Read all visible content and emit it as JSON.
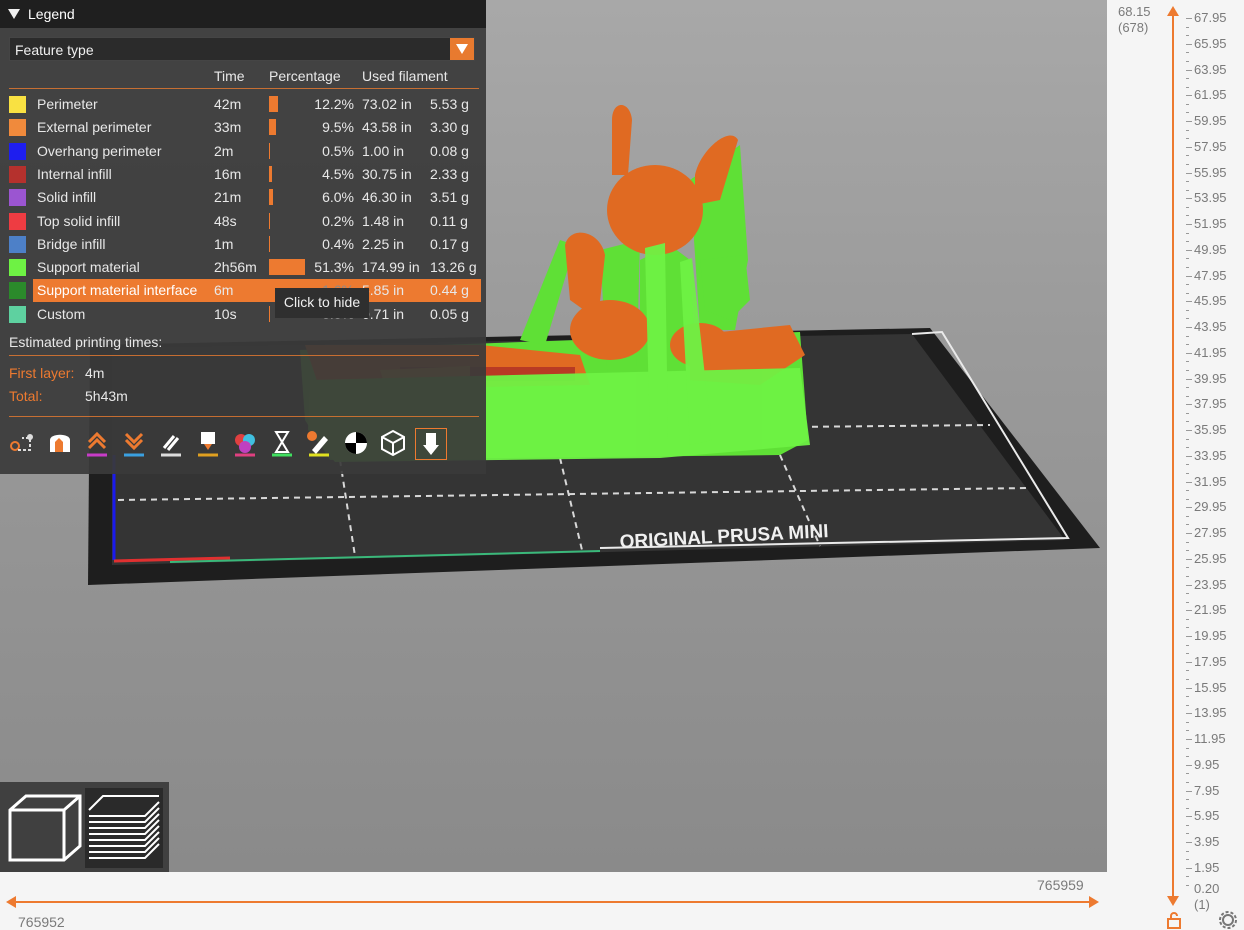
{
  "legend": {
    "title": "Legend",
    "view_type": "Feature type",
    "columns": {
      "time": "Time",
      "percentage": "Percentage",
      "used_filament": "Used filament"
    },
    "rows": [
      {
        "label": "Perimeter",
        "color": "#f9e142",
        "time": "42m",
        "percent": "12.2%",
        "pct_value": 12.2,
        "length": "73.02 in",
        "weight": "5.53 g"
      },
      {
        "label": "External perimeter",
        "color": "#f08a3c",
        "time": "33m",
        "percent": "9.5%",
        "pct_value": 9.5,
        "length": "43.58 in",
        "weight": "3.30 g"
      },
      {
        "label": "Overhang perimeter",
        "color": "#1e1eef",
        "time": "2m",
        "percent": "0.5%",
        "pct_value": 0.5,
        "length": "1.00 in",
        "weight": "0.08 g"
      },
      {
        "label": "Internal infill",
        "color": "#b5312d",
        "time": "16m",
        "percent": "4.5%",
        "pct_value": 4.5,
        "length": "30.75 in",
        "weight": "2.33 g"
      },
      {
        "label": "Solid infill",
        "color": "#9b55d1",
        "time": "21m",
        "percent": "6.0%",
        "pct_value": 6.0,
        "length": "46.30 in",
        "weight": "3.51 g"
      },
      {
        "label": "Top solid infill",
        "color": "#ee3c42",
        "time": "48s",
        "percent": "0.2%",
        "pct_value": 0.2,
        "length": "1.48 in",
        "weight": "0.11 g"
      },
      {
        "label": "Bridge infill",
        "color": "#4d80c8",
        "time": "1m",
        "percent": "0.4%",
        "pct_value": 0.4,
        "length": "2.25 in",
        "weight": "0.17 g"
      },
      {
        "label": "Support material",
        "color": "#6ef244",
        "time": "2h56m",
        "percent": "51.3%",
        "pct_value": 51.3,
        "length": "174.99 in",
        "weight": "13.26 g"
      },
      {
        "label": "Support material interface",
        "color": "#2b8a2b",
        "time": "6m",
        "percent": "1.6%",
        "pct_value": 1.6,
        "length": "5.85 in",
        "weight": "0.44 g"
      },
      {
        "label": "Custom",
        "color": "#5ed1a0",
        "time": "10s",
        "percent": "0.0%",
        "pct_value": 0.0,
        "length": "0.71 in",
        "weight": "0.05 g"
      }
    ],
    "tooltip": "Click to hide",
    "estimated_title": "Estimated printing times:",
    "first_layer_label": "First layer:",
    "first_layer_value": "4m",
    "total_label": "Total:",
    "total_value": "5h43m"
  },
  "bed_text": "ORIGINAL PRUSA MINI",
  "vertical_slider": {
    "top_value": "68.15",
    "top_layer": "(678)",
    "bottom_value": "0.20",
    "bottom_layer": "(1)",
    "ticks": [
      "67.95",
      "65.95",
      "63.95",
      "61.95",
      "59.95",
      "57.95",
      "55.95",
      "53.95",
      "51.95",
      "49.95",
      "47.95",
      "45.95",
      "43.95",
      "41.95",
      "39.95",
      "37.95",
      "35.95",
      "33.95",
      "31.95",
      "29.95",
      "27.95",
      "25.95",
      "23.95",
      "21.95",
      "19.95",
      "17.95",
      "15.95",
      "13.95",
      "11.95",
      "9.95",
      "7.95",
      "5.95",
      "3.95",
      "1.95"
    ]
  },
  "horizontal_slider": {
    "right_value": "765959",
    "left_value": "765952"
  },
  "colors": {
    "accent": "#ed7a30",
    "support_green": "#6ef244",
    "model_orange": "#e06a22"
  },
  "toolbar_icons": [
    "travel-icon",
    "wipe-icon",
    "retractions-icon",
    "deretractions-icon",
    "seams-icon",
    "tool-changes-icon",
    "color-changes-icon",
    "pause-icon",
    "custom-gcode-icon",
    "center-of-gravity-icon",
    "shells-icon",
    "tool-marker-icon"
  ]
}
